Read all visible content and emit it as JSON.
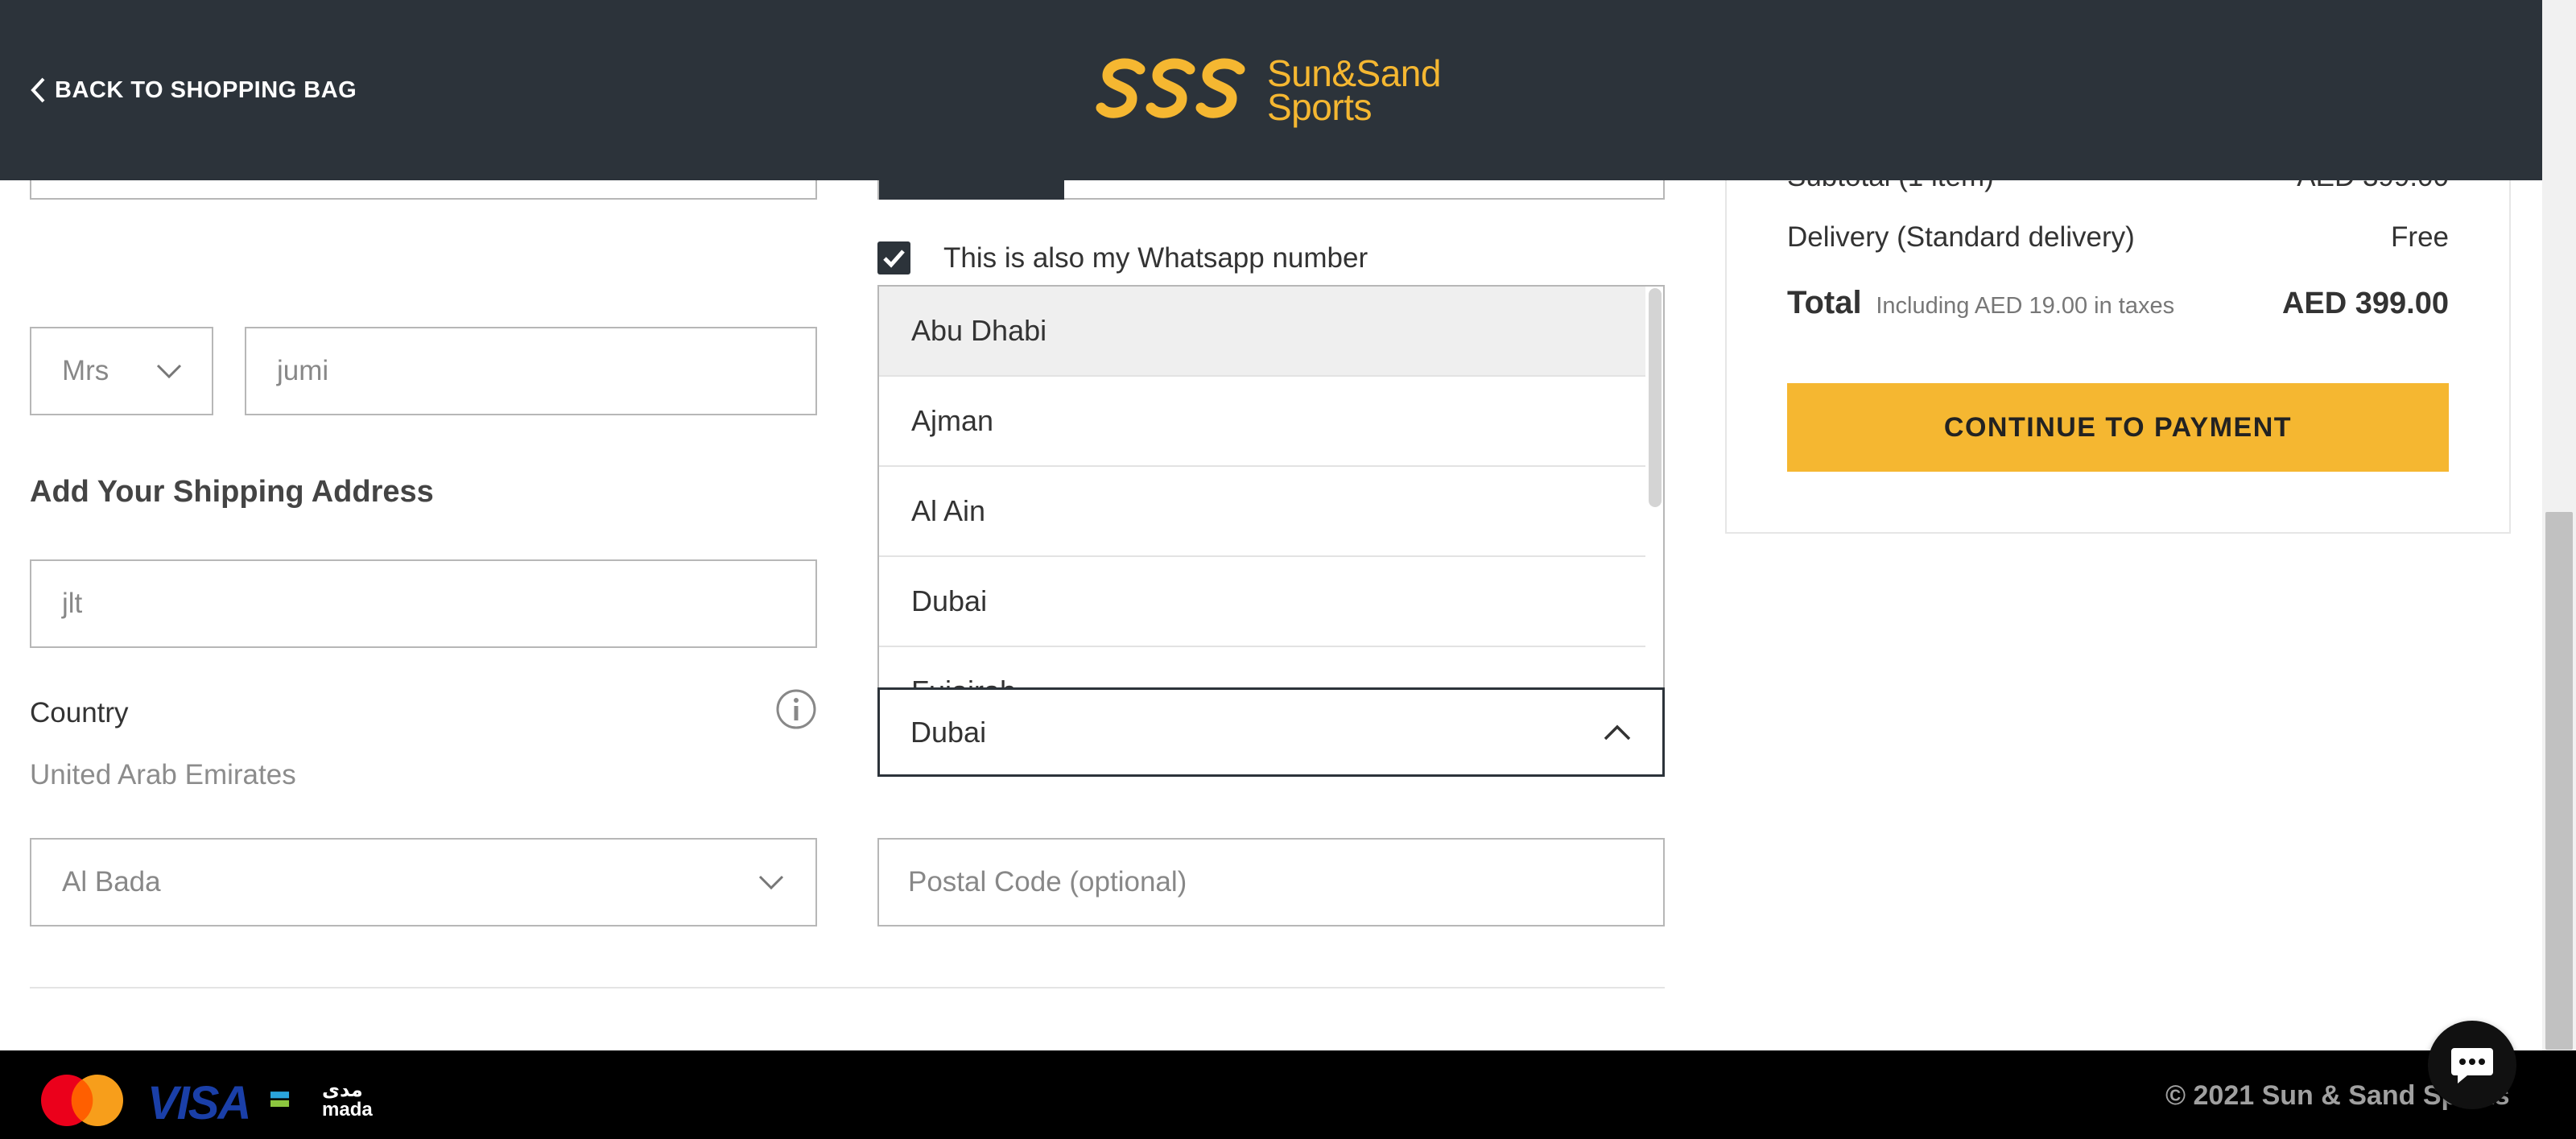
{
  "header": {
    "back_label": "BACK TO SHOPPING BAG",
    "logo_line1": "Sun&Sand",
    "logo_line2": "Sports"
  },
  "form": {
    "salutation": "Mrs",
    "first_name": "jumi",
    "section_title": "Add Your Shipping Address",
    "address": "jlt",
    "country_label": "Country",
    "country_value": "United Arab Emirates",
    "area": "Al Bada",
    "whatsapp_label": "This is also my Whatsapp number",
    "whatsapp_checked": true,
    "city_options": [
      "Abu Dhabi",
      "Ajman",
      "Al Ain",
      "Dubai",
      "Fujairah"
    ],
    "city_selected": "Dubai",
    "postal_placeholder": "Postal Code (optional)"
  },
  "summary": {
    "subtotal_label": "Subtotal (1 item)",
    "subtotal_value": "AED 399.00",
    "delivery_label": "Delivery (Standard delivery)",
    "delivery_value": "Free",
    "total_label": "Total",
    "total_note": "Including AED 19.00 in taxes",
    "total_value": "AED 399.00",
    "pay_button": "CONTINUE TO PAYMENT"
  },
  "footer": {
    "visa": "VISA",
    "mada_ar": "مدى",
    "mada_en": "mada",
    "copyright": "© 2021 Sun & Sand Sports"
  },
  "colors": {
    "header_bg": "#2c333a",
    "brand_yellow": "#f5b731",
    "footer_bg": "#000000"
  }
}
